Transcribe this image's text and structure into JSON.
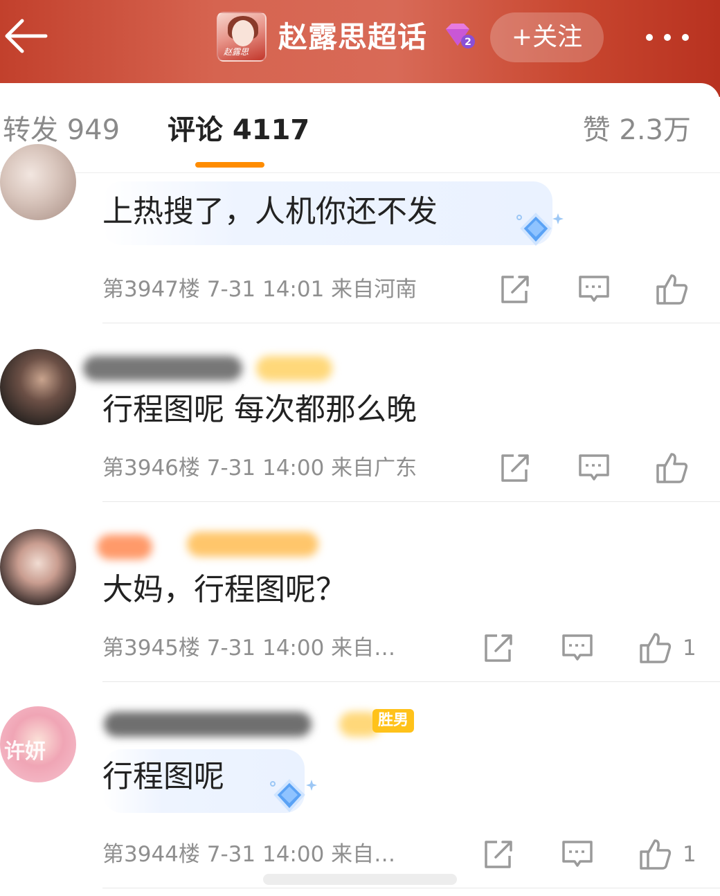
{
  "header": {
    "title": "赵露思超话",
    "follow_label": "+关注",
    "logo_caption": "赵露思",
    "level": "2",
    "colors": {
      "bar": "#c8462f",
      "accent": "#ff8c00"
    }
  },
  "tabs": [
    {
      "label": "转发 949",
      "active": false
    },
    {
      "label": "评论 4117",
      "active": true
    },
    {
      "label": "赞 2.3万",
      "active": false
    }
  ],
  "comments": [
    {
      "text": "上热搜了，人机你还不发",
      "floor": "第3947楼",
      "time": "7-31 14:01",
      "location": "来自河南",
      "likes": "",
      "has_gem": true
    },
    {
      "text": "行程图呢 每次都那么晚",
      "floor": "第3946楼",
      "time": "7-31 14:00",
      "location": "来自广东",
      "likes": "",
      "has_gem": false
    },
    {
      "text": "大妈，行程图呢？",
      "floor": "第3945楼",
      "time": "7-31 14:00",
      "location": "来自…",
      "likes": "1",
      "has_gem": false
    },
    {
      "text": "行程图呢",
      "floor": "第3944楼",
      "time": "7-31 14:00",
      "location": "来自…",
      "likes": "1",
      "has_gem": true,
      "badge": "胜男",
      "avatar_text": "许妍"
    }
  ],
  "icons": [
    "back-arrow-icon",
    "diamond-level-icon",
    "more-dots-icon",
    "repost-icon",
    "comment-icon",
    "thumbs-up-icon",
    "diamond-gem-icon"
  ]
}
